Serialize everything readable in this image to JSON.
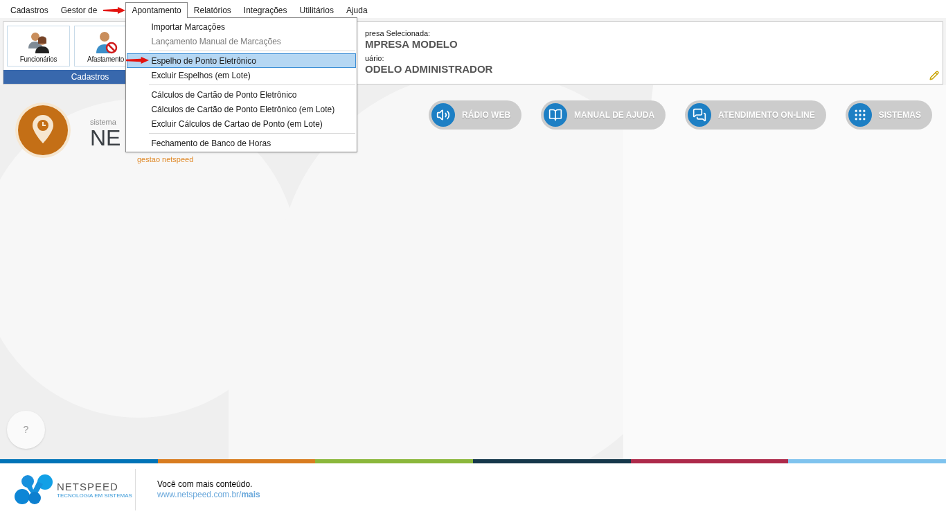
{
  "menubar": [
    {
      "label": "Cadastros",
      "selected": false
    },
    {
      "label": "Gestor de",
      "selected": false
    },
    {
      "label": "Apontamento",
      "selected": true
    },
    {
      "label": "Relatórios",
      "selected": false
    },
    {
      "label": "Integrações",
      "selected": false
    },
    {
      "label": "Utilitários",
      "selected": false
    },
    {
      "label": "Ajuda",
      "selected": false
    }
  ],
  "dropdown": [
    {
      "kind": "item",
      "label": "Importar Marcações",
      "disabled": false,
      "selected": false
    },
    {
      "kind": "item",
      "label": "Lançamento Manual de Marcações",
      "disabled": true,
      "selected": false
    },
    {
      "kind": "separator"
    },
    {
      "kind": "item",
      "label": "Espelho de Ponto Eletrônico",
      "disabled": false,
      "selected": true
    },
    {
      "kind": "item",
      "label": "Excluir Espelhos (em Lote)",
      "disabled": false,
      "selected": false
    },
    {
      "kind": "separator"
    },
    {
      "kind": "item",
      "label": "Cálculos de Cartão de Ponto Eletrônico",
      "disabled": false,
      "selected": false
    },
    {
      "kind": "item",
      "label": "Cálculos de Cartão de Ponto Eletrônico (em Lote)",
      "disabled": false,
      "selected": false
    },
    {
      "kind": "item",
      "label": "Excluir Cálculos de Cartao de Ponto (em Lote)",
      "disabled": false,
      "selected": false
    },
    {
      "kind": "separator"
    },
    {
      "kind": "item",
      "label": "Fechamento de Banco de Horas",
      "disabled": false,
      "selected": false
    }
  ],
  "ribbon": {
    "group_label": "Cadastros",
    "buttons": [
      {
        "kind": "people",
        "label": "Funcionários"
      },
      {
        "kind": "absence",
        "label": "Afastamento"
      }
    ]
  },
  "info": {
    "company_label": "presa Selecionada:",
    "company": "MPRESA MODELO",
    "user_label": "uário:",
    "user": "ODELO ADMINISTRADOR"
  },
  "brand": {
    "small": "sistema",
    "big": "NE",
    "tagline": "gestao netspeed"
  },
  "actions": [
    {
      "kind": "radio",
      "label": "RÁDIO WEB"
    },
    {
      "kind": "manual",
      "label": "MANUAL DE AJUDA"
    },
    {
      "kind": "chat",
      "label": "ATENDIMENTO ON-LINE"
    },
    {
      "kind": "apps",
      "label": "SISTEMAS"
    }
  ],
  "help": {
    "label": "?"
  },
  "stripe": [
    {
      "color": "#0073b7"
    },
    {
      "color": "#d87c1f"
    },
    {
      "color": "#8bb73b"
    },
    {
      "color": "#15374a"
    },
    {
      "color": "#ad2a4a"
    },
    {
      "color": "#7fc3ee"
    }
  ],
  "footer": {
    "logo_name": "NETSPEED",
    "logo_tagline": "TECNOLOGIA EM SISTEMAS",
    "text": "Você com mais conteúdo.",
    "link": "www.netspeed.com.br/**mais**"
  }
}
